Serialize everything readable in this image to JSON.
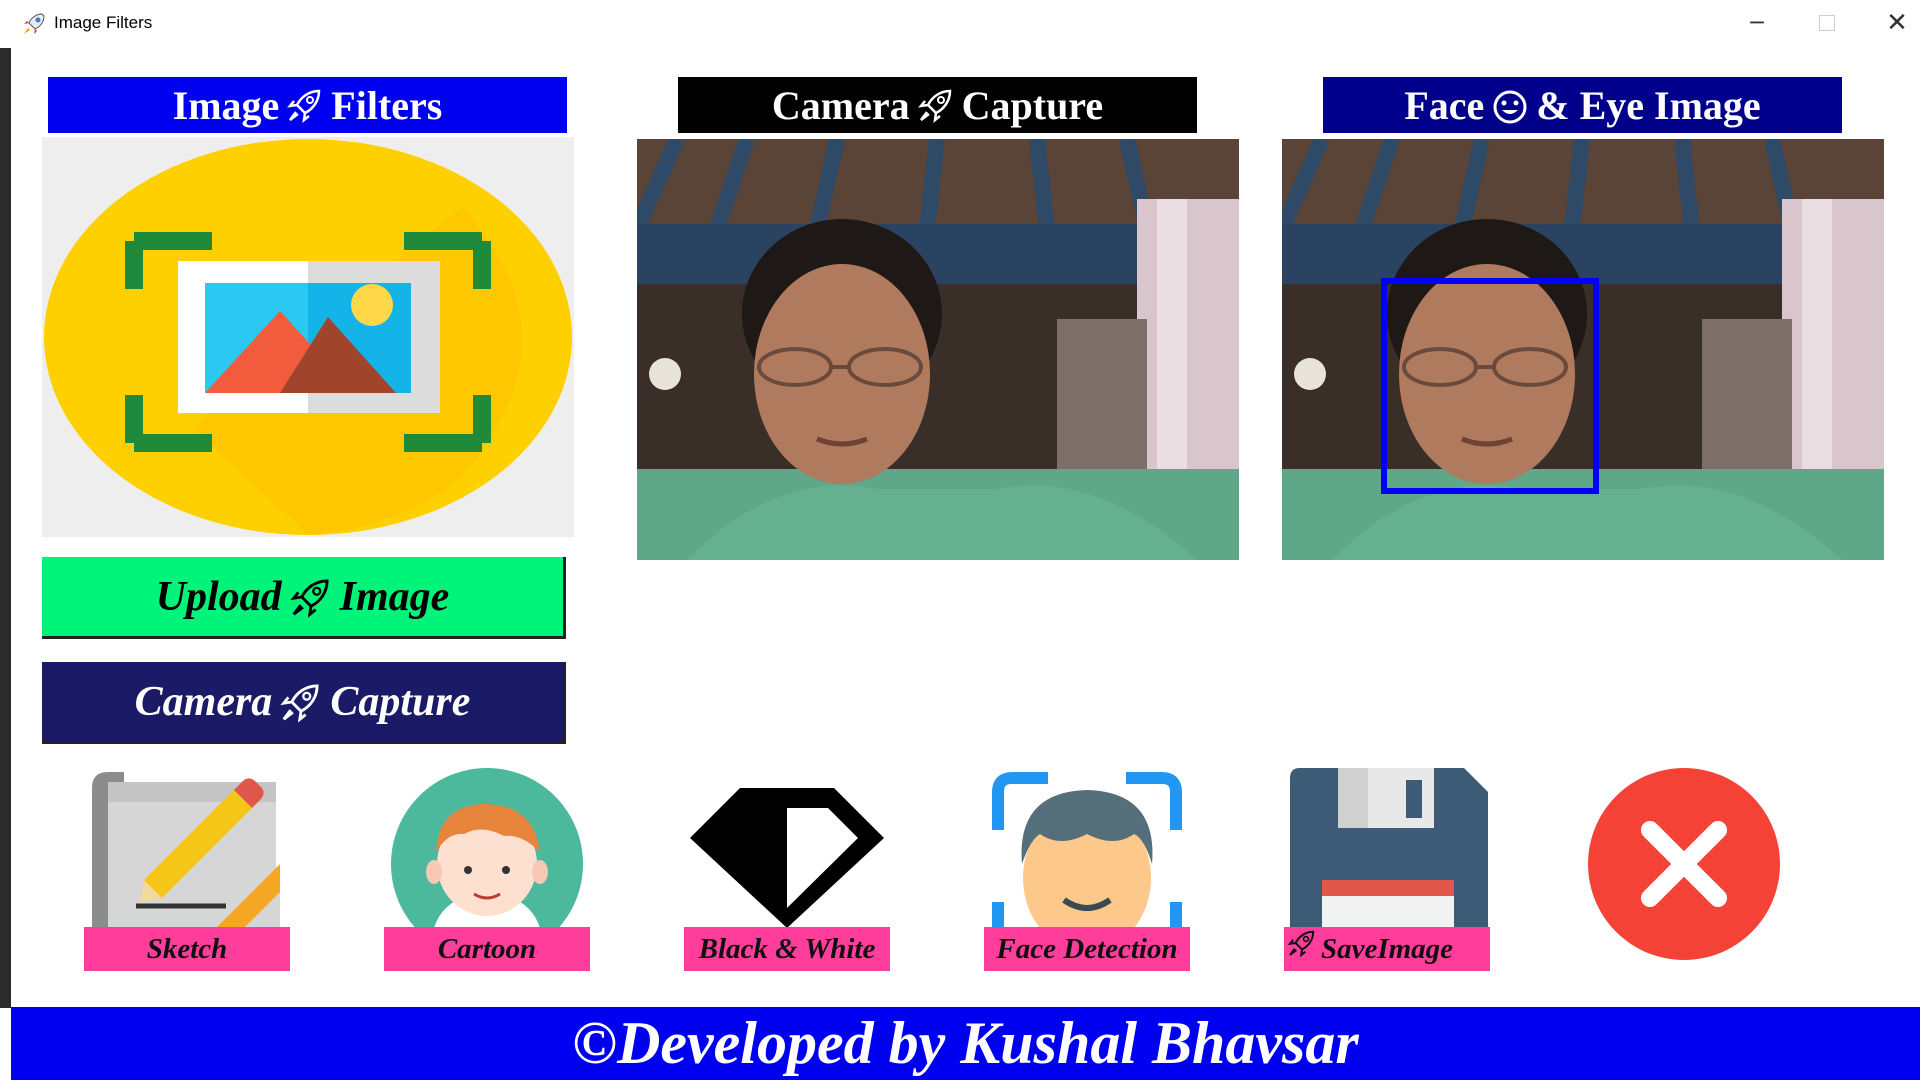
{
  "window": {
    "title": "Image Filters",
    "minimize_glyph": "─",
    "close_glyph": "✕"
  },
  "headers": {
    "filters_left": "Image",
    "filters_right": "Filters",
    "camera_left": "Camera",
    "camera_right": "Capture",
    "face_left": "Face",
    "face_right": "& Eye Image"
  },
  "buttons": {
    "upload_left": "Upload",
    "upload_right": "Image",
    "camera_left": "Camera",
    "camera_right": "Capture"
  },
  "tools": [
    {
      "label": "Sketch",
      "icon": "sketch-pencil-icon"
    },
    {
      "label": "Cartoon",
      "icon": "cartoon-face-icon"
    },
    {
      "label": "Black & White",
      "icon": "contrast-diamond-icon"
    },
    {
      "label": "Face Detection",
      "icon": "face-scan-icon"
    },
    {
      "label": "Save",
      "label_right": "Image",
      "icon": "floppy-disk-icon"
    }
  ],
  "exit_icon": "close-circle-icon",
  "footer": "©Developed by Kushal Bhavsar",
  "colors": {
    "header_blue": "#0000f0",
    "header_black": "#000000",
    "header_navy": "#00008b",
    "upload_green": "#00f47a",
    "camera_navy": "#1a1a66",
    "label_pink": "#ff3d9a",
    "exit_red": "#f44336",
    "face_box_blue": "#0000ff"
  }
}
